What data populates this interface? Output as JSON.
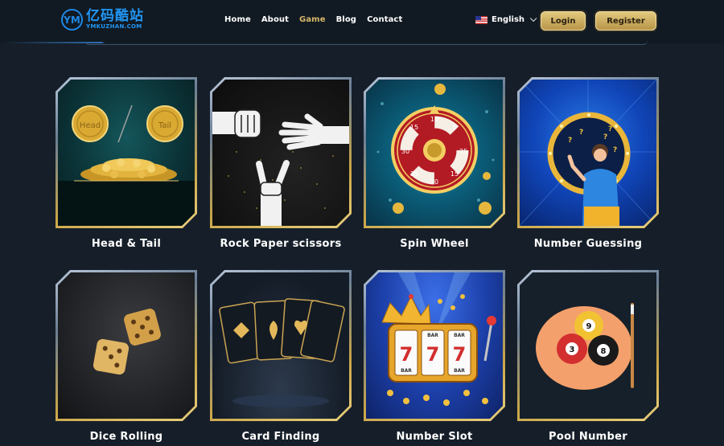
{
  "brand": {
    "mark": "YM",
    "name_cn": "亿码酷站",
    "name_en": "YMKUZHAN.COM",
    "color": "#2196f3"
  },
  "nav": {
    "items": [
      {
        "label": "Home"
      },
      {
        "label": "About"
      },
      {
        "label": "Game",
        "active": true
      },
      {
        "label": "Blog"
      },
      {
        "label": "Contact"
      }
    ]
  },
  "language": {
    "selected": "English",
    "icon": "us-flag-icon"
  },
  "auth": {
    "login_label": "Login",
    "register_label": "Register"
  },
  "colors": {
    "background": "#161f29",
    "accent_gold": "#d8b86a"
  },
  "games": [
    {
      "title": "Head & Tail",
      "coin_left": "Head",
      "coin_right": "Tail"
    },
    {
      "title": "Rock Paper scissors"
    },
    {
      "title": "Spin Wheel",
      "wheel_numbers": [
        "10",
        "5",
        "25",
        "15",
        "20",
        "35",
        "30",
        "15"
      ]
    },
    {
      "title": "Number Guessing"
    },
    {
      "title": "Dice Rolling"
    },
    {
      "title": "Card Finding"
    },
    {
      "title": "Number Slot",
      "reel_symbols": [
        "7",
        "7",
        "7"
      ],
      "reel_label": "BAR"
    },
    {
      "title": "Pool Number",
      "balls": [
        "9",
        "3",
        "8"
      ]
    }
  ]
}
